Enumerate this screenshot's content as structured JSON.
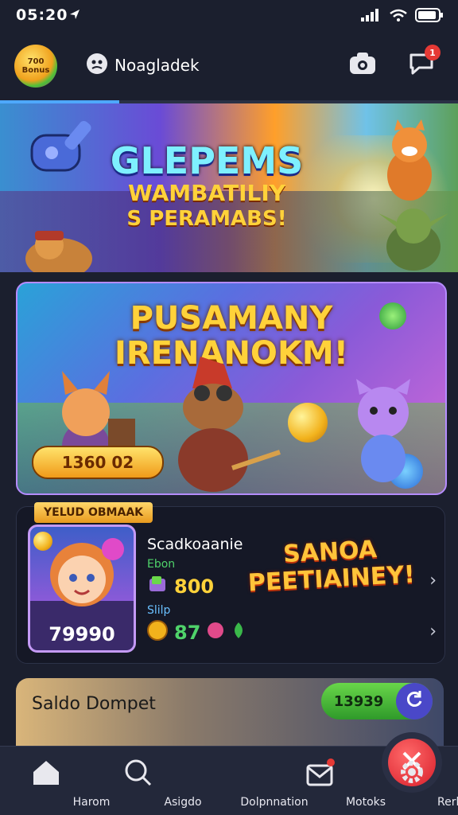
{
  "status_bar": {
    "time": "05:20",
    "icons": [
      "location-arrow-icon",
      "signal-icon",
      "wifi-icon",
      "battery-icon"
    ]
  },
  "header": {
    "logo_text": "700 Bonus",
    "username": "Noagladek",
    "camera_icon": "camera-icon",
    "chat_icon": "chat-icon",
    "notification_count": "1"
  },
  "banner_top": {
    "title_line1": "GLEPEMS",
    "title_line2": "WAMBATILIY",
    "title_line3": "S PERAMABS!",
    "progress_percent": 26
  },
  "banner_main": {
    "title_line1": "PUSAMANY",
    "title_line2": "IRENANOKM!",
    "amount": "1360 02"
  },
  "player_card": {
    "tag": "YELUD OBMAAK",
    "avatar_value": "79990",
    "name": "Scadkoaanie",
    "sub1": "Ebon",
    "stat1": "800",
    "sub2": "Slilp",
    "stat2": "87",
    "promo_line1": "SANOA",
    "promo_line2": "PEETIAINEY!"
  },
  "saldo": {
    "label": "Saldo Dompet",
    "amount": "13939"
  },
  "bottom_nav": {
    "items": [
      {
        "label": "Harom",
        "icon": "home-icon"
      },
      {
        "label": "Asigdo",
        "icon": "search-icon"
      },
      {
        "label": "Dolpnnation",
        "icon": "gift-icon"
      },
      {
        "label": "Motoks",
        "icon": "mailbox-icon"
      },
      {
        "label": "Rerlary",
        "icon": "gear-icon"
      }
    ]
  },
  "colors": {
    "accent": "#4ea8ff",
    "gold": "#ffd23a",
    "green": "#4fd36a",
    "bg": "#1b1f2e"
  }
}
